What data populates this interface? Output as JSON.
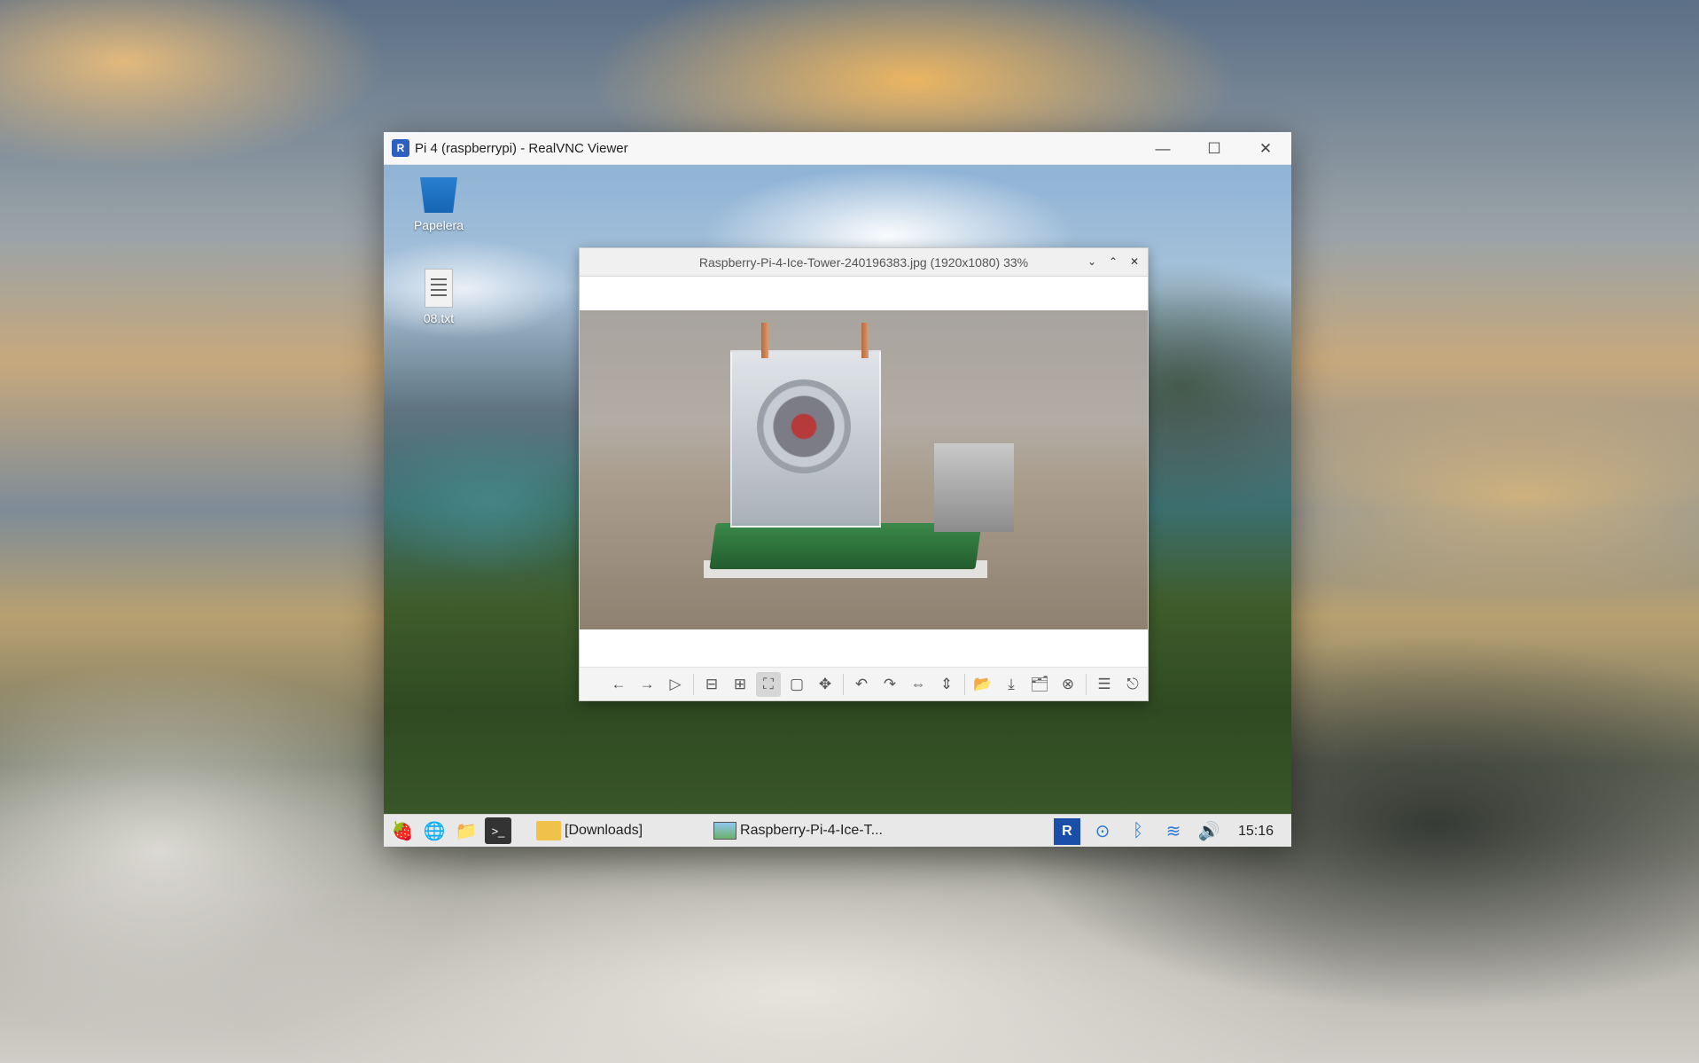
{
  "host_window": {
    "title": "Pi 4 (raspberrypi) - RealVNC Viewer",
    "app_icon_text": "R",
    "controls": {
      "minimize": "—",
      "maximize": "☐",
      "close": "✕"
    }
  },
  "remote_desktop": {
    "icons": [
      {
        "label": "Papelera",
        "icon": "trash-icon"
      },
      {
        "label": "08.txt",
        "icon": "text-file-icon"
      }
    ]
  },
  "image_viewer": {
    "title": "Raspberry-Pi-4-Ice-Tower-240196383.jpg (1920x1080) 33%",
    "controls": {
      "minimize": "⌄",
      "maximize": "⌃",
      "close": "✕"
    },
    "toolbar": [
      {
        "name": "previous-button",
        "glyph": "←"
      },
      {
        "name": "next-button",
        "glyph": "→"
      },
      {
        "name": "slideshow-button",
        "glyph": "▷"
      },
      {
        "sep": true
      },
      {
        "name": "zoom-out-button",
        "glyph": "⊟"
      },
      {
        "name": "zoom-in-button",
        "glyph": "⊞"
      },
      {
        "name": "fit-window-button",
        "glyph": "⛶",
        "active": true
      },
      {
        "name": "original-size-button",
        "glyph": "▢"
      },
      {
        "name": "fullscreen-button",
        "glyph": "✥"
      },
      {
        "sep": true
      },
      {
        "name": "rotate-left-button",
        "glyph": "↶"
      },
      {
        "name": "rotate-right-button",
        "glyph": "↷"
      },
      {
        "name": "flip-horizontal-button",
        "glyph": "⇔"
      },
      {
        "name": "flip-vertical-button",
        "glyph": "⇕"
      },
      {
        "sep": true
      },
      {
        "name": "open-button",
        "glyph": "📂"
      },
      {
        "name": "save-button",
        "glyph": "⤓"
      },
      {
        "name": "save-as-button",
        "glyph": "🗂"
      },
      {
        "name": "delete-button",
        "glyph": "⊗"
      },
      {
        "sep": true
      },
      {
        "name": "preferences-button",
        "glyph": "☰"
      },
      {
        "name": "exit-button",
        "glyph": "⎋"
      }
    ]
  },
  "taskbar": {
    "launchers": [
      {
        "name": "raspberry-menu-icon",
        "glyph": "🍓"
      },
      {
        "name": "browser-icon",
        "glyph": "🌐"
      },
      {
        "name": "file-manager-icon",
        "glyph": "📁"
      },
      {
        "name": "terminal-icon",
        "glyph": ">_"
      }
    ],
    "tasks": [
      {
        "label": "[Downloads]",
        "icon": "folder-icon"
      },
      {
        "label": "Raspberry-Pi-4-Ice-T...",
        "icon": "image-icon"
      }
    ],
    "tray": [
      {
        "name": "vnc-tray-icon",
        "glyph": "R"
      },
      {
        "name": "update-icon",
        "glyph": "⊙"
      },
      {
        "name": "bluetooth-icon",
        "glyph": "ᛒ"
      },
      {
        "name": "wifi-icon",
        "glyph": "≋"
      },
      {
        "name": "volume-icon",
        "glyph": "🔊"
      }
    ],
    "clock": "15:16"
  }
}
